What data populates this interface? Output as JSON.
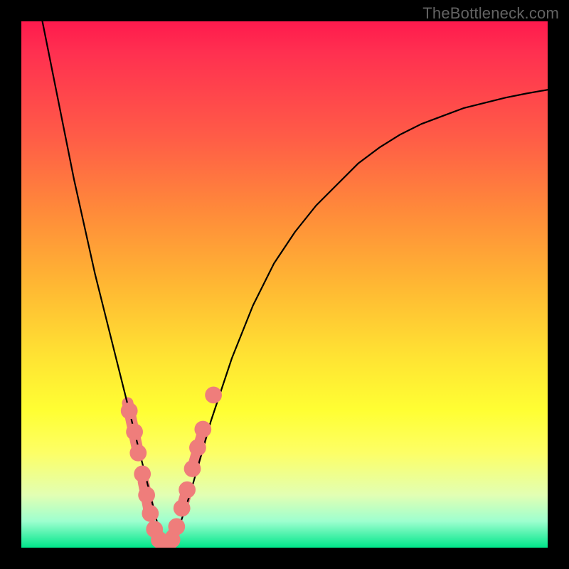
{
  "watermark": "TheBottleneck.com",
  "colors": {
    "marker": "#ef7d7b",
    "curve": "#000000",
    "gradient_top": "#ff1a4d",
    "gradient_bottom": "#00e68a"
  },
  "chart_data": {
    "type": "line",
    "title": "",
    "xlabel": "",
    "ylabel": "",
    "xlim": [
      0,
      100
    ],
    "ylim": [
      0,
      100
    ],
    "grid": false,
    "legend": false,
    "series": [
      {
        "name": "bottleneck-curve",
        "x": [
          4,
          6,
          8,
          10,
          12,
          14,
          16,
          18,
          20,
          21,
          22,
          23,
          24,
          25,
          26,
          27,
          28,
          29,
          30,
          32,
          34,
          36,
          38,
          40,
          44,
          48,
          52,
          56,
          60,
          64,
          68,
          72,
          76,
          80,
          84,
          88,
          92,
          96,
          100
        ],
        "y": [
          100,
          90,
          80,
          70,
          61,
          52,
          44,
          36,
          28,
          24,
          20,
          16,
          12,
          8,
          4,
          1,
          0,
          1,
          4,
          10,
          17,
          24,
          30,
          36,
          46,
          54,
          60,
          65,
          69,
          73,
          76,
          78.5,
          80.5,
          82,
          83.5,
          84.5,
          85.5,
          86.3,
          87
        ]
      }
    ],
    "markers": [
      {
        "x": 20.5,
        "y": 26,
        "r": 1.2
      },
      {
        "x": 21.5,
        "y": 22,
        "r": 1.2
      },
      {
        "x": 22.2,
        "y": 18,
        "r": 1.2
      },
      {
        "x": 23.0,
        "y": 14,
        "r": 1.2
      },
      {
        "x": 23.8,
        "y": 10,
        "r": 1.2
      },
      {
        "x": 24.5,
        "y": 6.5,
        "r": 1.2
      },
      {
        "x": 25.3,
        "y": 3.5,
        "r": 1.2
      },
      {
        "x": 26.2,
        "y": 1.5,
        "r": 1.2
      },
      {
        "x": 27.0,
        "y": 0.5,
        "r": 1.2
      },
      {
        "x": 27.8,
        "y": 0.5,
        "r": 1.2
      },
      {
        "x": 28.6,
        "y": 1.5,
        "r": 1.2
      },
      {
        "x": 29.5,
        "y": 4.0,
        "r": 1.2
      },
      {
        "x": 30.5,
        "y": 7.5,
        "r": 1.2
      },
      {
        "x": 31.5,
        "y": 11,
        "r": 1.2
      },
      {
        "x": 32.5,
        "y": 15,
        "r": 1.2
      },
      {
        "x": 33.5,
        "y": 19,
        "r": 1.2
      },
      {
        "x": 34.5,
        "y": 22.5,
        "r": 1.2
      },
      {
        "x": 36.5,
        "y": 29,
        "r": 1.2
      }
    ],
    "capsules": [
      {
        "x1": 20.2,
        "y1": 27.5,
        "x2": 22.0,
        "y2": 19.0
      },
      {
        "x1": 23.2,
        "y1": 12.5,
        "x2": 24.2,
        "y2": 7.5
      },
      {
        "x1": 25.0,
        "y1": 4.0,
        "x2": 27.0,
        "y2": 0.8
      },
      {
        "x1": 27.2,
        "y1": 0.6,
        "x2": 29.5,
        "y2": 3.5
      },
      {
        "x1": 30.5,
        "y1": 7.5,
        "x2": 31.5,
        "y2": 11.0
      },
      {
        "x1": 32.8,
        "y1": 16.0,
        "x2": 34.5,
        "y2": 22.0
      }
    ]
  }
}
